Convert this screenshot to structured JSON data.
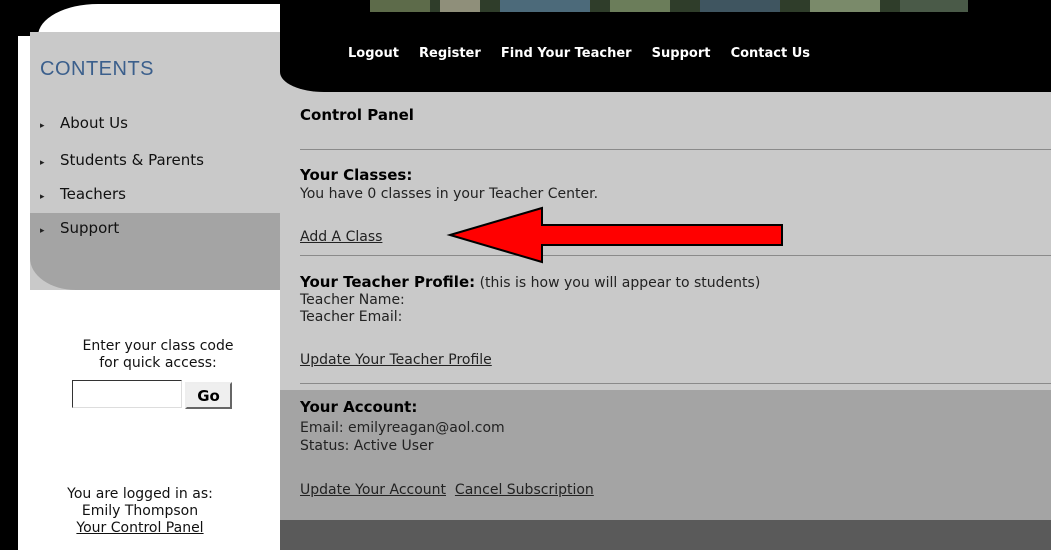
{
  "sidebar": {
    "title": "CONTENTS",
    "items": [
      {
        "label": "About Us"
      },
      {
        "label": "Students & Parents"
      },
      {
        "label": "Teachers"
      },
      {
        "label": "Support"
      }
    ],
    "class_code": {
      "prompt_line1": "Enter your class code",
      "prompt_line2": "for quick access:",
      "input_value": "",
      "go_label": "Go"
    },
    "login": {
      "line1": "You are logged in as:",
      "user_name": "Emily Thompson",
      "control_panel_link": "Your Control Panel"
    }
  },
  "top_nav": {
    "items": [
      "Logout",
      "Register",
      "Find Your Teacher",
      "Support",
      "Contact Us"
    ]
  },
  "main": {
    "title": "Control Panel",
    "classes": {
      "heading": "Your Classes:",
      "count_text": "You have 0 classes in your Teacher Center.",
      "add_link": "Add A Class"
    },
    "profile": {
      "heading": "Your Teacher Profile:",
      "heading_note": " (this is how you will appear to students)",
      "name_label": "Teacher Name:",
      "email_label": "Teacher Email:",
      "update_link": "Update Your Teacher Profile"
    },
    "account": {
      "heading": "Your Account:",
      "email_text": "Email: emilyreagan@aol.com",
      "status_text": "Status: Active User",
      "update_link": "Update Your Account",
      "cancel_link": "Cancel Subscription"
    }
  },
  "colors": {
    "panel_gray": "#c9c9c9",
    "section_dark_gray": "#a4a4a4",
    "contents_title": "#3b5f8c",
    "annotation_arrow": "#ff0000"
  },
  "icons": {
    "nav_bullet": "triangle-bullet-icon",
    "annotation": "red-arrow-icon"
  }
}
